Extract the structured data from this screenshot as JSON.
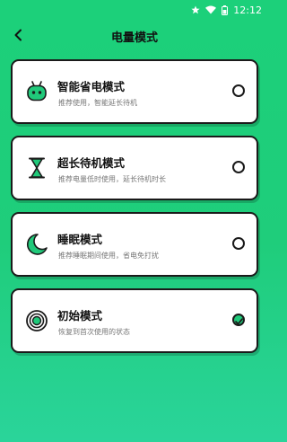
{
  "status": {
    "time": "12:12",
    "icons": [
      "star-icon",
      "wifi-icon",
      "battery-icon"
    ]
  },
  "header": {
    "back_icon": "chevron-left-icon",
    "title": "电量模式"
  },
  "modes": [
    {
      "name": "智能省电模式",
      "desc": "推荐使用，智能延长待机",
      "icon": "robot-icon",
      "selected": false
    },
    {
      "name": "超长待机模式",
      "desc": "推荐电量低时使用，延长待机时长",
      "icon": "hourglass-icon",
      "selected": false
    },
    {
      "name": "睡眠模式",
      "desc": "推荐睡眠期间使用，省电免打扰",
      "icon": "moon-icon",
      "selected": false
    },
    {
      "name": "初始模式",
      "desc": "恢复到首次使用的状态",
      "icon": "target-icon",
      "selected": true
    }
  ],
  "colors": {
    "accent": "#20c97a",
    "background_top": "#1cd07a",
    "background_bottom": "#2ad49a",
    "border": "#1a1a1a"
  }
}
